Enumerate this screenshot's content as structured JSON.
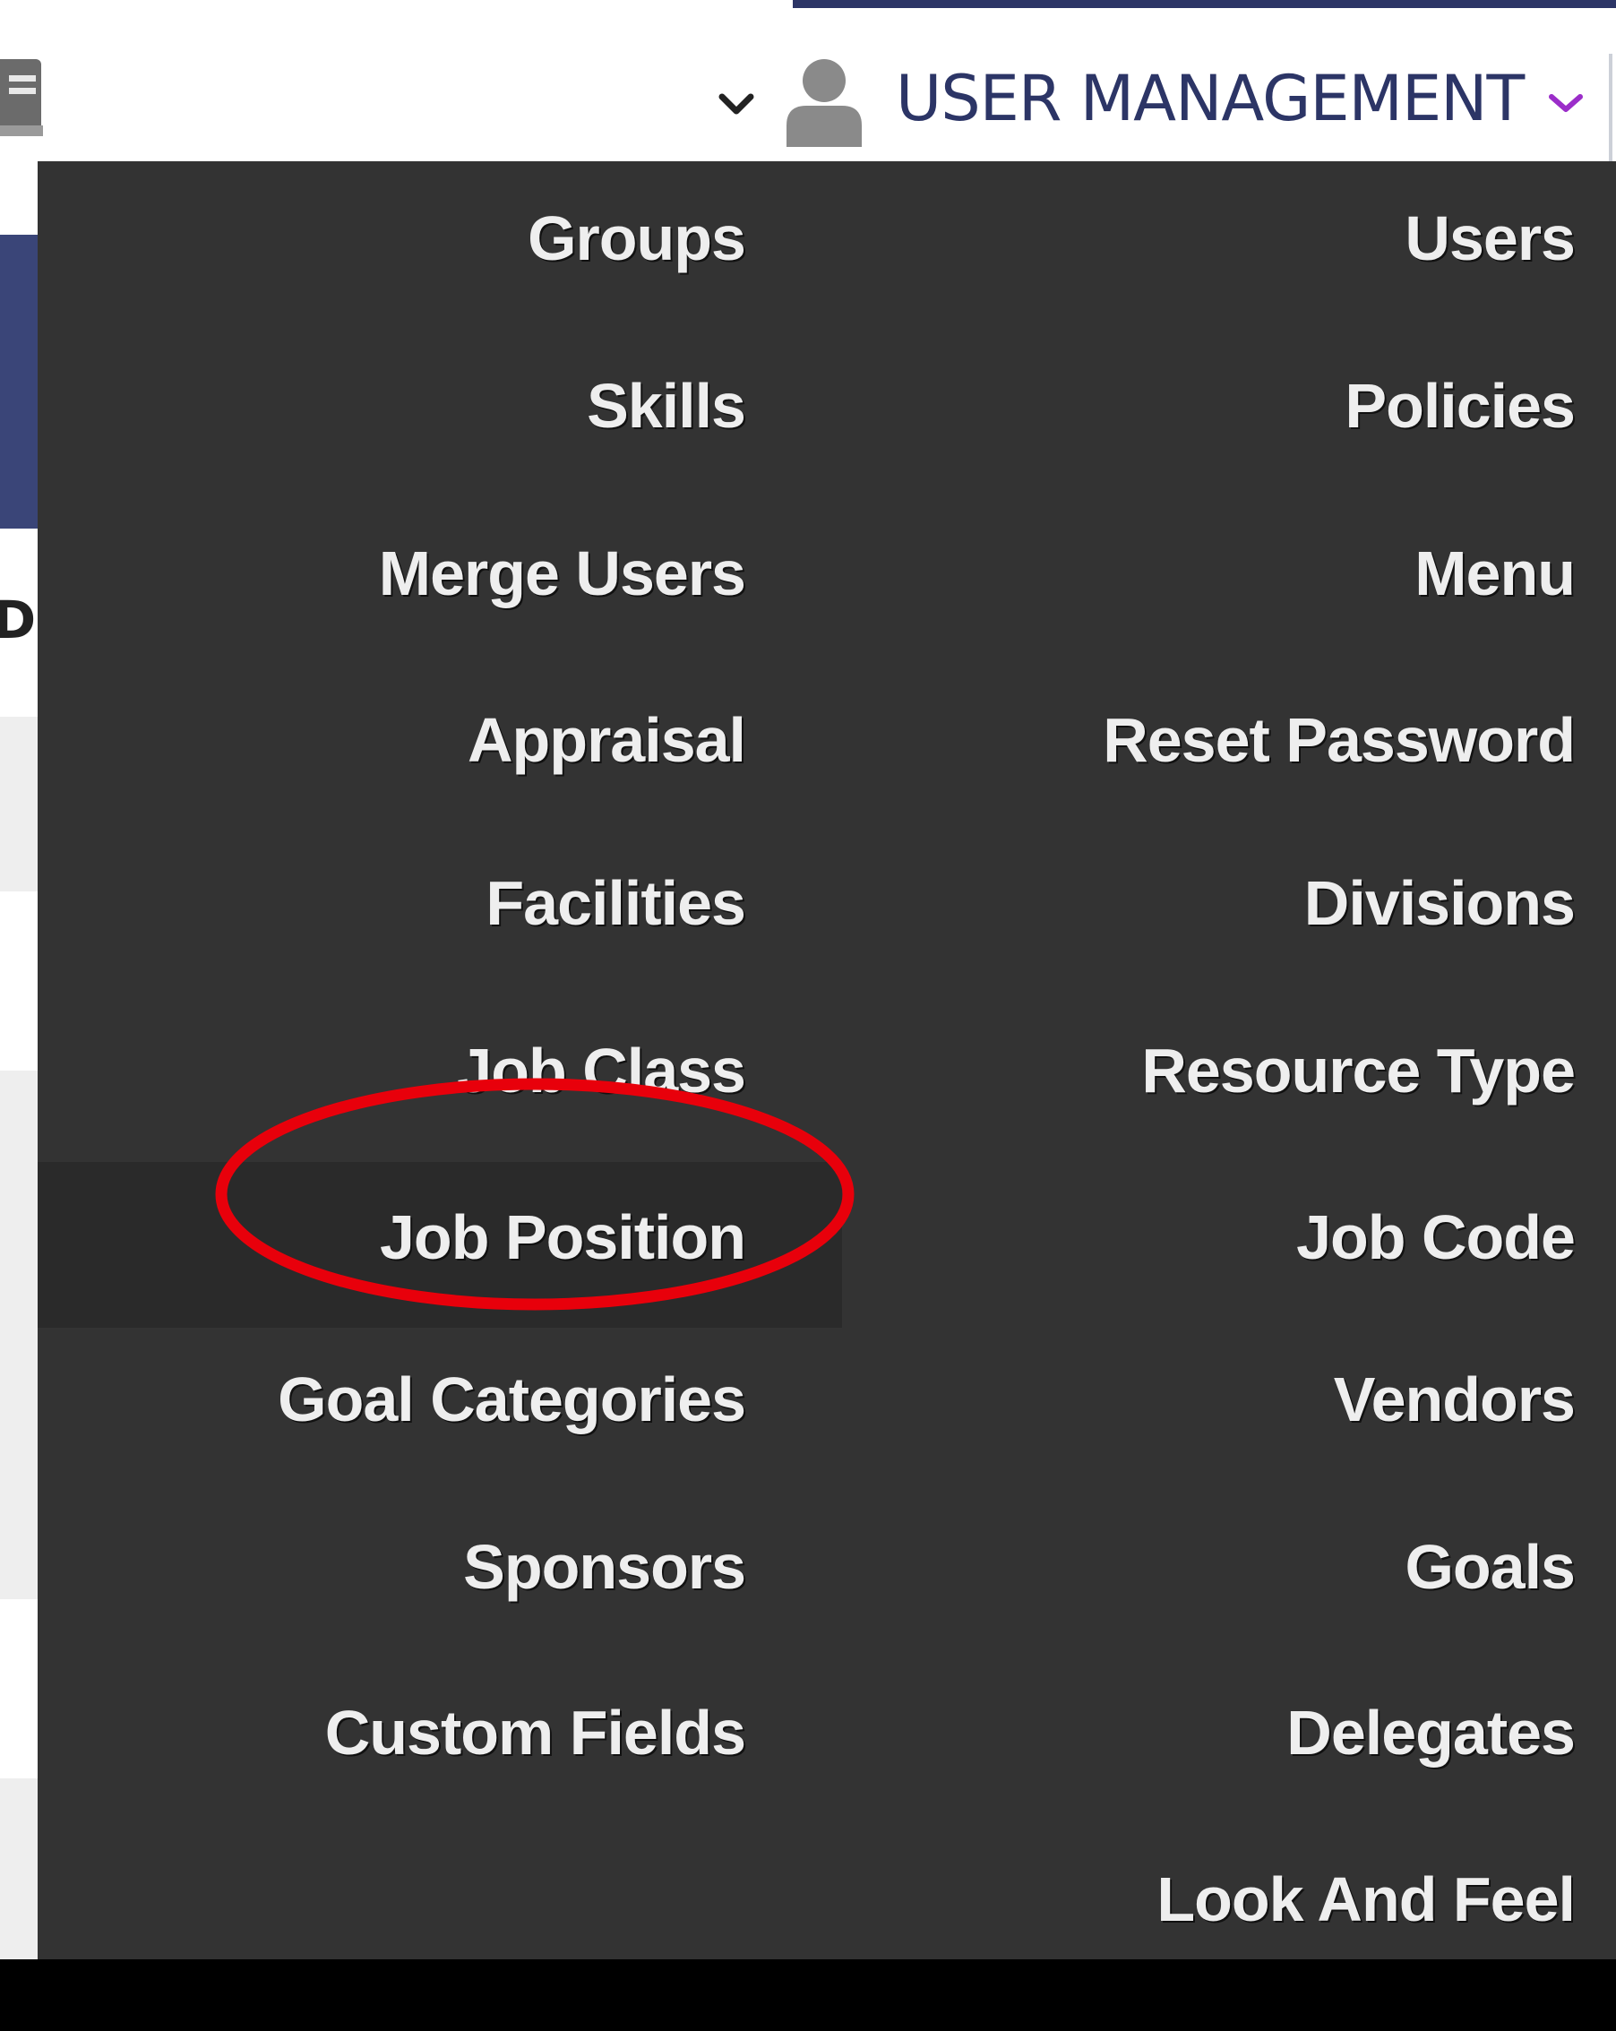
{
  "header": {
    "title": "USER MANAGEMENT",
    "icons": {
      "left": "document-icon",
      "caret_left": "chevron-down-icon",
      "user": "user-icon",
      "caret_right": "chevron-down-icon"
    },
    "title_color": "#2c3566",
    "caret_right_color": "#9b2dc9"
  },
  "background": {
    "fragment_text": "D"
  },
  "menu": {
    "background_color": "#333333",
    "text_color": "#eeeeee",
    "highlighted_item": "Job Position",
    "left_column": [
      "Groups",
      "Skills",
      "Merge Users",
      "Appraisal",
      "Facilities",
      "Job Class",
      "Job Position",
      "Goal Categories",
      "Sponsors",
      "Custom Fields"
    ],
    "right_column": [
      "Users",
      "Policies",
      "Menu",
      "Reset Password",
      "Divisions",
      "Resource Type",
      "Job Code",
      "Vendors",
      "Goals",
      "Delegates",
      "Look And Feel"
    ]
  },
  "annotation": {
    "shape": "ellipse",
    "color": "#e8000b",
    "target": "Job Position"
  }
}
